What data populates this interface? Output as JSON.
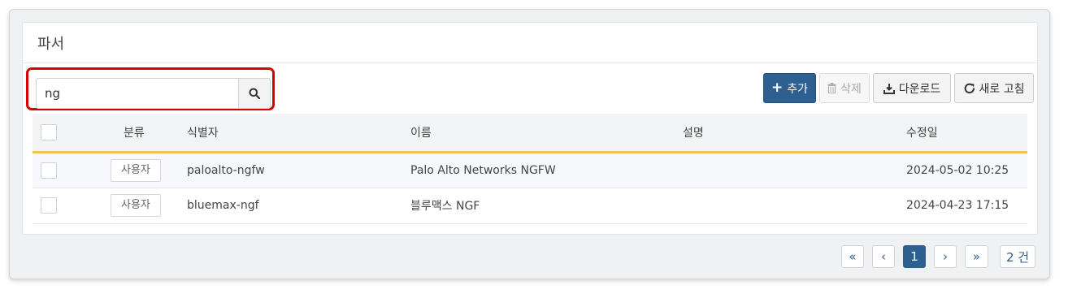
{
  "panel": {
    "title": "파서"
  },
  "search": {
    "value": "ng",
    "placeholder": ""
  },
  "toolbar": {
    "add_label": "추가",
    "delete_label": "삭제",
    "download_label": "다운로드",
    "refresh_label": "새로 고침"
  },
  "table": {
    "headers": [
      "",
      "분류",
      "식별자",
      "이름",
      "설명",
      "수정일"
    ],
    "rows": [
      {
        "category": "사용자",
        "id": "paloalto-ngfw",
        "name": "Palo Alto Networks NGFW",
        "description": "",
        "modified": "2024-05-02 10:25"
      },
      {
        "category": "사용자",
        "id": "bluemax-ngf",
        "name": "블루맥스 NGF",
        "description": "",
        "modified": "2024-04-23 17:15"
      }
    ]
  },
  "pagination": {
    "first": "«",
    "prev": "‹",
    "current": "1",
    "next": "›",
    "last": "»",
    "total": "2 건"
  },
  "colors": {
    "primary": "#2e5f91",
    "highlight_border": "#d90000",
    "header_underline": "#f0c15d"
  }
}
